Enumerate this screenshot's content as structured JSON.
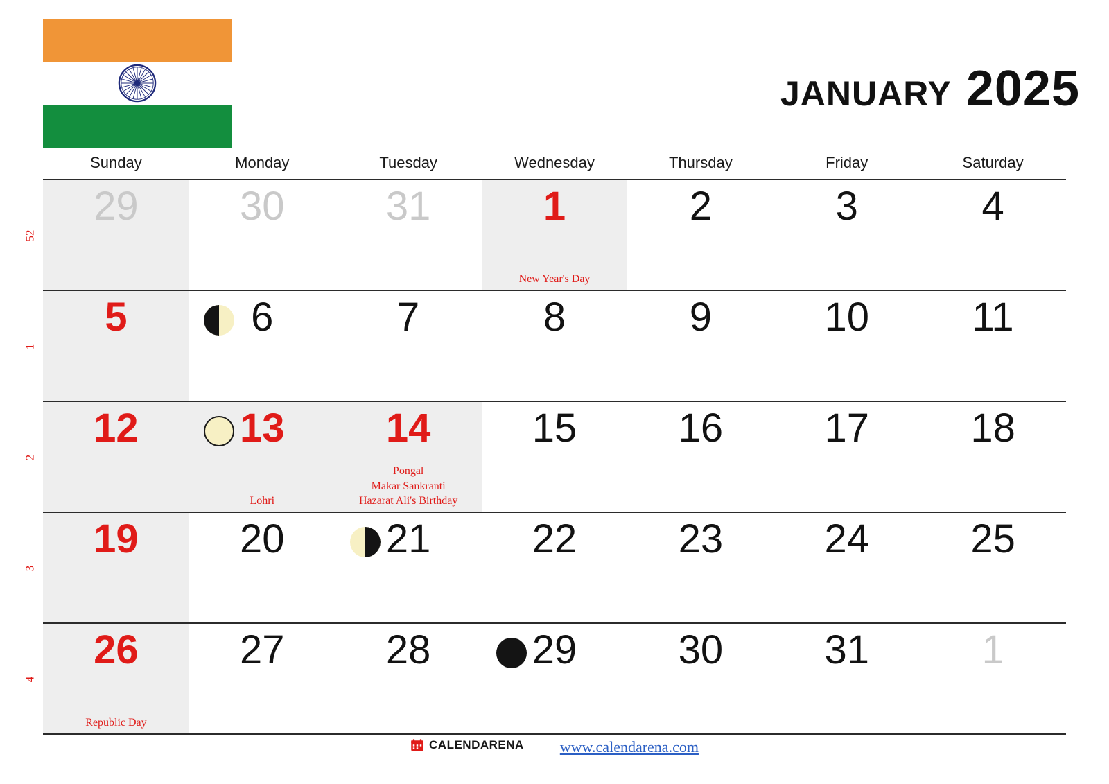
{
  "header": {
    "title": "January 2025",
    "flag": {
      "name": "india-flag",
      "saffron": "#f09537",
      "white": "#ffffff",
      "green": "#138e3e",
      "chakra_color": "#1f2a7a"
    }
  },
  "weekdays": [
    "Sunday",
    "Monday",
    "Tuesday",
    "Wednesday",
    "Thursday",
    "Friday",
    "Saturday"
  ],
  "colors": {
    "holiday_red": "#e01b18",
    "shaded_cell": "#eeeeee",
    "muted_day": "#c9c9c9",
    "grid_line": "#2b2b2b",
    "link_blue": "#2b5fc4",
    "moon_light": "#f7f0c4",
    "moon_dark": "#141414"
  },
  "weeks": [
    {
      "week_number": "52",
      "days": [
        {
          "num": "29",
          "type": "outside",
          "shaded": true,
          "moon": "",
          "holidays": []
        },
        {
          "num": "30",
          "type": "outside",
          "shaded": false,
          "moon": "",
          "holidays": []
        },
        {
          "num": "31",
          "type": "outside",
          "shaded": false,
          "moon": "",
          "holidays": []
        },
        {
          "num": "1",
          "type": "holiday",
          "shaded": true,
          "moon": "",
          "holidays": [
            "New Year's Day"
          ]
        },
        {
          "num": "2",
          "type": "normal",
          "shaded": false,
          "moon": "",
          "holidays": []
        },
        {
          "num": "3",
          "type": "normal",
          "shaded": false,
          "moon": "",
          "holidays": []
        },
        {
          "num": "4",
          "type": "normal",
          "shaded": false,
          "moon": "",
          "holidays": []
        }
      ]
    },
    {
      "week_number": "1",
      "days": [
        {
          "num": "5",
          "type": "sunday",
          "shaded": true,
          "moon": "",
          "holidays": []
        },
        {
          "num": "6",
          "type": "normal",
          "shaded": false,
          "moon": "first-quarter-moon",
          "holidays": []
        },
        {
          "num": "7",
          "type": "normal",
          "shaded": false,
          "moon": "",
          "holidays": []
        },
        {
          "num": "8",
          "type": "normal",
          "shaded": false,
          "moon": "",
          "holidays": []
        },
        {
          "num": "9",
          "type": "normal",
          "shaded": false,
          "moon": "",
          "holidays": []
        },
        {
          "num": "10",
          "type": "normal",
          "shaded": false,
          "moon": "",
          "holidays": []
        },
        {
          "num": "11",
          "type": "normal",
          "shaded": false,
          "moon": "",
          "holidays": []
        }
      ]
    },
    {
      "week_number": "2",
      "days": [
        {
          "num": "12",
          "type": "sunday",
          "shaded": true,
          "moon": "",
          "holidays": []
        },
        {
          "num": "13",
          "type": "holiday",
          "shaded": true,
          "moon": "full-moon",
          "holidays": [
            "Lohri"
          ]
        },
        {
          "num": "14",
          "type": "holiday",
          "shaded": true,
          "moon": "",
          "holidays": [
            "Pongal",
            "Makar Sankranti",
            "Hazarat Ali's Birthday"
          ]
        },
        {
          "num": "15",
          "type": "normal",
          "shaded": false,
          "moon": "",
          "holidays": []
        },
        {
          "num": "16",
          "type": "normal",
          "shaded": false,
          "moon": "",
          "holidays": []
        },
        {
          "num": "17",
          "type": "normal",
          "shaded": false,
          "moon": "",
          "holidays": []
        },
        {
          "num": "18",
          "type": "normal",
          "shaded": false,
          "moon": "",
          "holidays": []
        }
      ]
    },
    {
      "week_number": "3",
      "days": [
        {
          "num": "19",
          "type": "sunday",
          "shaded": true,
          "moon": "",
          "holidays": []
        },
        {
          "num": "20",
          "type": "normal",
          "shaded": false,
          "moon": "",
          "holidays": []
        },
        {
          "num": "21",
          "type": "normal",
          "shaded": false,
          "moon": "last-quarter-moon",
          "holidays": []
        },
        {
          "num": "22",
          "type": "normal",
          "shaded": false,
          "moon": "",
          "holidays": []
        },
        {
          "num": "23",
          "type": "normal",
          "shaded": false,
          "moon": "",
          "holidays": []
        },
        {
          "num": "24",
          "type": "normal",
          "shaded": false,
          "moon": "",
          "holidays": []
        },
        {
          "num": "25",
          "type": "normal",
          "shaded": false,
          "moon": "",
          "holidays": []
        }
      ]
    },
    {
      "week_number": "4",
      "days": [
        {
          "num": "26",
          "type": "holiday",
          "shaded": true,
          "moon": "",
          "holidays": [
            "Republic Day"
          ]
        },
        {
          "num": "27",
          "type": "normal",
          "shaded": false,
          "moon": "",
          "holidays": []
        },
        {
          "num": "28",
          "type": "normal",
          "shaded": false,
          "moon": "",
          "holidays": []
        },
        {
          "num": "29",
          "type": "normal",
          "shaded": false,
          "moon": "new-moon",
          "holidays": []
        },
        {
          "num": "30",
          "type": "normal",
          "shaded": false,
          "moon": "",
          "holidays": []
        },
        {
          "num": "31",
          "type": "normal",
          "shaded": false,
          "moon": "",
          "holidays": []
        },
        {
          "num": "1",
          "type": "outside",
          "shaded": false,
          "moon": "",
          "holidays": []
        }
      ]
    }
  ],
  "footer": {
    "brand_name": "CALENDARENA",
    "brand_icon": "calendar-icon",
    "url": "www.calendarena.com"
  }
}
